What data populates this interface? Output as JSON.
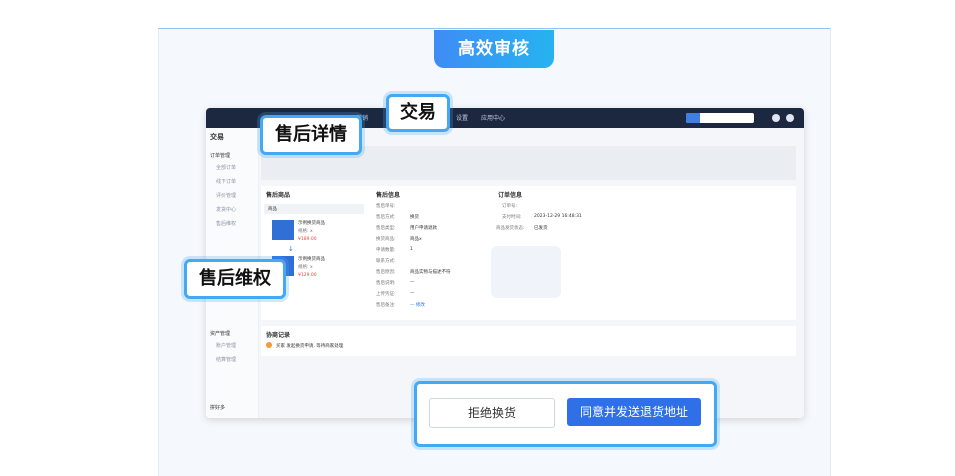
{
  "banner": {
    "title": "高效审核"
  },
  "callouts": {
    "after_sale_detail": "售后详情",
    "trade": "交易",
    "after_sale_rights": "售后维权"
  },
  "actions": {
    "reject_label": "拒绝换货",
    "agree_label": "同意并发送退货地址"
  },
  "screenshot": {
    "topbar": {
      "items": [
        "营销",
        "设置",
        "应用中心"
      ]
    },
    "sidebar": {
      "title": "交易",
      "group_order": "订单管理",
      "order_items": [
        "全部订单",
        "线下订单",
        "评价管理",
        "发货中心",
        "售后维权"
      ],
      "group_other": "资产管理",
      "other_items": [
        "账户管理",
        "结算管理"
      ],
      "footer": "拼好多"
    },
    "sections": {
      "products": "售后商品",
      "after_sale_info": "售后信息",
      "order_info": "订单信息",
      "records": "协商记录"
    },
    "product_header": "商品",
    "products": [
      {
        "name": "示例换货商品",
        "spec": "规格: x",
        "price": "¥189.00"
      },
      {
        "name": "示例换货商品",
        "spec": "规格: x",
        "price": "¥129.00"
      }
    ],
    "info_labels": [
      "售后单号:",
      "售后方式:",
      "售后类型:",
      "换货商品:",
      "申请数量:",
      "联系方式:",
      "售后原因:",
      "售后说明:",
      "上传凭证:",
      "售后备注:"
    ],
    "info_values": [
      "",
      "换货",
      "用户申请退款",
      "商品x",
      "1",
      "",
      "商品实物与描述不符",
      "—",
      "—",
      "—  修改"
    ],
    "order_labels": [
      "订单号:",
      "支付时间:",
      "商品发货状态:"
    ],
    "order_values": [
      "",
      "2023-12-29 16:48:31",
      "已发货"
    ],
    "record_text": "买家 发起换货申请, 等待商家处理"
  }
}
